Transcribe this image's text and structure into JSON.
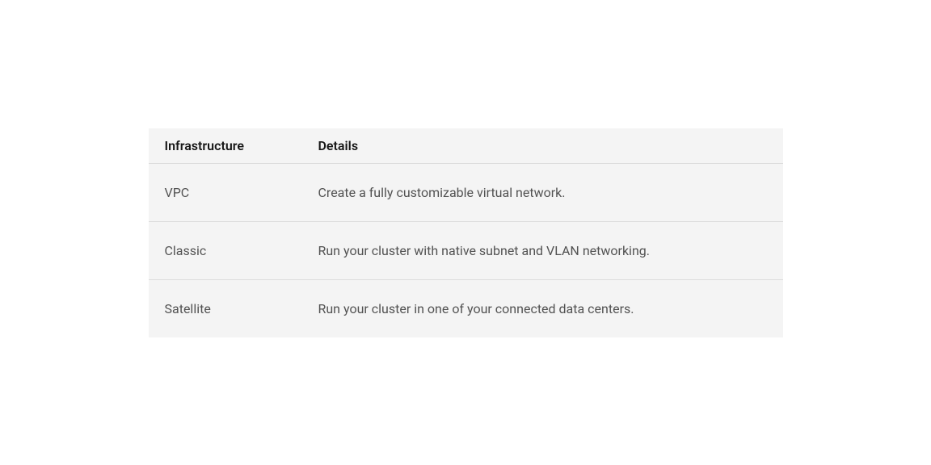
{
  "table": {
    "headers": {
      "infrastructure": "Infrastructure",
      "details": "Details"
    },
    "rows": [
      {
        "infrastructure": "VPC",
        "details": "Create a fully customizable virtual network."
      },
      {
        "infrastructure": "Classic",
        "details": "Run your cluster with native subnet and VLAN networking."
      },
      {
        "infrastructure": "Satellite",
        "details": "Run your cluster in one of your connected data centers."
      }
    ]
  }
}
